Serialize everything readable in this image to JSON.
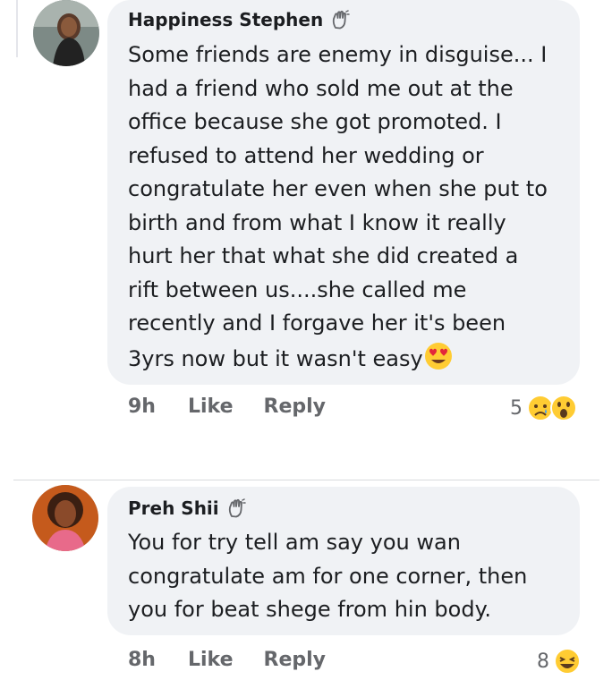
{
  "comments": [
    {
      "author": "Happiness Stephen",
      "author_badge_icon": "wave-icon",
      "lines": [
        "Some friends are enemy in disguise... I",
        "had a friend who sold me out at the",
        "office because she got promoted. I",
        "refused to attend her wedding or",
        "congratulate her even when she put to",
        "birth and from what I know it really",
        "hurt her that what she did created a",
        "rift between us....she called me",
        "recently and I forgave her it's been",
        "3yrs now but it wasn't easy"
      ],
      "trailing_emoji": "heart-eyes-emoji",
      "time": "9h",
      "like_label": "Like",
      "reply_label": "Reply",
      "reaction_count": "5",
      "reaction_icons": [
        "sad-emoji",
        "wow-emoji"
      ]
    },
    {
      "author": "Preh Shii",
      "author_badge_icon": "wave-icon",
      "lines": [
        "You for try tell am say you wan",
        "congratulate am for one corner, then",
        "you for beat shege from hin body."
      ],
      "time": "8h",
      "like_label": "Like",
      "reply_label": "Reply",
      "reaction_count": "8",
      "reaction_icons": [
        "laugh-emoji"
      ]
    }
  ],
  "colors": {
    "bubble": "#f0f2f5",
    "text": "#1c1e21",
    "meta": "#65676b"
  }
}
